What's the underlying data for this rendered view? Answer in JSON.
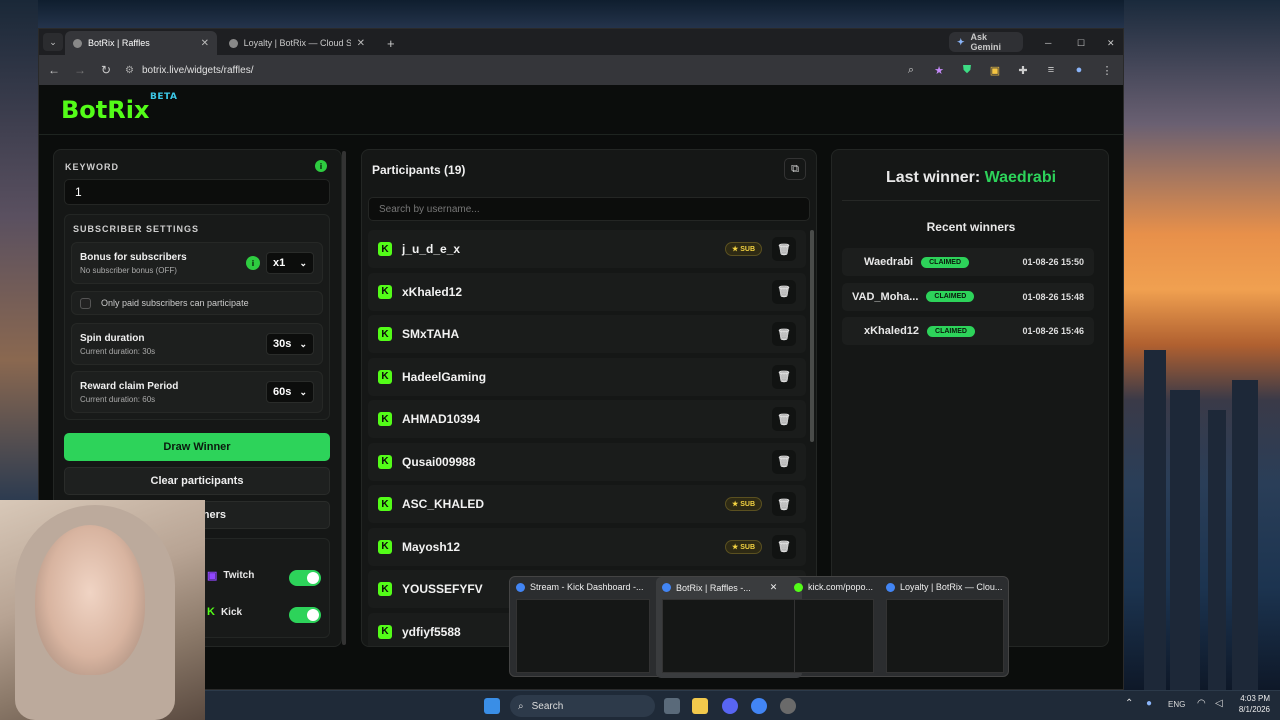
{
  "browser": {
    "tabs": [
      {
        "title": "BotRix | Raffles",
        "active": true
      },
      {
        "title": "Loyalty | BotRix — Cloud Stream",
        "active": false
      }
    ],
    "ask_gemini": "Ask Gemini",
    "url": "botrix.live/widgets/raffles/"
  },
  "app": {
    "logo": "BotRix",
    "badge": "BETA"
  },
  "settings": {
    "keyword_label": "KEYWORD",
    "keyword_value": "1",
    "subscriber_settings_label": "SUBSCRIBER SETTINGS",
    "bonus_title": "Bonus for subscribers",
    "bonus_sub": "No subscriber bonus (OFF)",
    "bonus_value": "x1",
    "paid_only": "Only paid subscribers can participate",
    "spin_title": "Spin duration",
    "spin_sub": "Current duration: 30s",
    "spin_value": "30s",
    "reward_title": "Reward claim Period",
    "reward_sub": "Current duration: 60s",
    "reward_value": "60s",
    "draw_winner": "Draw Winner",
    "clear_participants": "Clear participants",
    "winners_button_partial": "nners",
    "platforms": [
      {
        "name": "Twitch",
        "enabled": true
      },
      {
        "name": "Kick",
        "enabled": true
      }
    ]
  },
  "participants": {
    "title": "Participants (19)",
    "search_placeholder": "Search by username...",
    "list": [
      {
        "name": "j_u_d_e_x",
        "sub": true
      },
      {
        "name": "xKhaled12",
        "sub": false
      },
      {
        "name": "SMxTAHA",
        "sub": false
      },
      {
        "name": "HadeelGaming",
        "sub": false
      },
      {
        "name": "AHMAD10394",
        "sub": false
      },
      {
        "name": "Qusai009988",
        "sub": false
      },
      {
        "name": "ASC_KHALED",
        "sub": true
      },
      {
        "name": "Mayosh12",
        "sub": true
      },
      {
        "name": "YOUSSEFYFV",
        "sub": false
      },
      {
        "name": "ydfiyf5588",
        "sub": false
      }
    ],
    "sub_label": "SUB"
  },
  "winners": {
    "last_label": "Last winner:",
    "last_name": "Waedrabi",
    "recent_title": "Recent winners",
    "claimed_label": "CLAIMED",
    "list": [
      {
        "name": "Waedrabi",
        "date": "01-08-26 15:50"
      },
      {
        "name": "VAD_Moha...",
        "date": "01-08-26 15:48"
      },
      {
        "name": "xKhaled12",
        "date": "01-08-26 15:46"
      }
    ]
  },
  "taskbar": {
    "search": "Search",
    "lang": "ENG",
    "time": "4:03 PM",
    "date": "8/1/2026",
    "previews": [
      {
        "title": "Stream - Kick Dashboard -..."
      },
      {
        "title": "BotRix | Raffles -..."
      },
      {
        "title": "kick.com/popo..."
      },
      {
        "title": "Loyalty | BotRix — Clou..."
      }
    ]
  },
  "colors": {
    "accent": "#2dd35a",
    "kick": "#53fc18",
    "brand": "#53fc18"
  }
}
